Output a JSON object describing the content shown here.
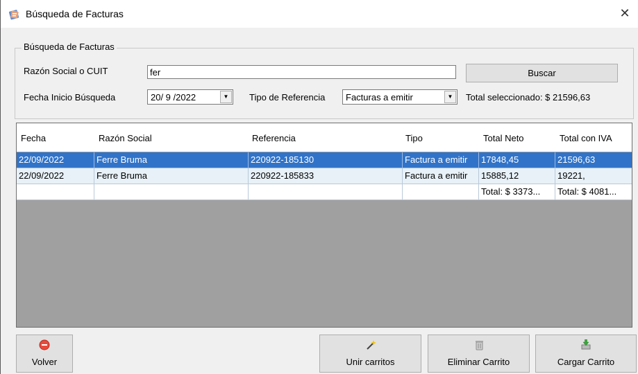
{
  "window": {
    "title": "Búsqueda de Facturas",
    "close_glyph": "✕"
  },
  "search": {
    "group_title": "Búsqueda de Facturas",
    "razon_label": "Razón Social o CUIT",
    "razon_value": "fer",
    "buscar_label": "Buscar",
    "fecha_label": "Fecha Inicio Búsqueda",
    "fecha_value": "20/ 9 /2022",
    "tipo_label": "Tipo de Referencia",
    "tipo_value": "Facturas a emitir",
    "total_seleccionado": "Total seleccionado: $ 21596,63"
  },
  "grid": {
    "columns": [
      "Fecha",
      "Razón Social",
      "Referencia",
      "Tipo",
      "Total Neto",
      "Total con IVA"
    ],
    "rows": [
      [
        "22/09/2022",
        "Ferre Bruma",
        "220922-185130",
        "Factura a emitir",
        "17848,45",
        "21596,63"
      ],
      [
        "22/09/2022",
        "Ferre Bruma",
        "220922-185833",
        "Factura a emitir",
        "15885,12",
        "19221,"
      ]
    ],
    "totals": [
      "",
      "",
      "",
      "",
      "Total: $ 3373...",
      "Total: $ 4081..."
    ]
  },
  "buttons": {
    "volver": "Volver",
    "unir": "Unir carritos",
    "eliminar": "Eliminar Carrito",
    "cargar": "Cargar Carrito"
  },
  "icons": {
    "app": "invoice-app-icon",
    "volver": "stop-icon",
    "unir": "magic-wand-icon",
    "eliminar": "trash-icon",
    "cargar": "cart-download-icon"
  },
  "colors": {
    "selection": "#3173c8",
    "alt_row": "#e7f1f7",
    "grid_empty": "#a0a0a0"
  }
}
